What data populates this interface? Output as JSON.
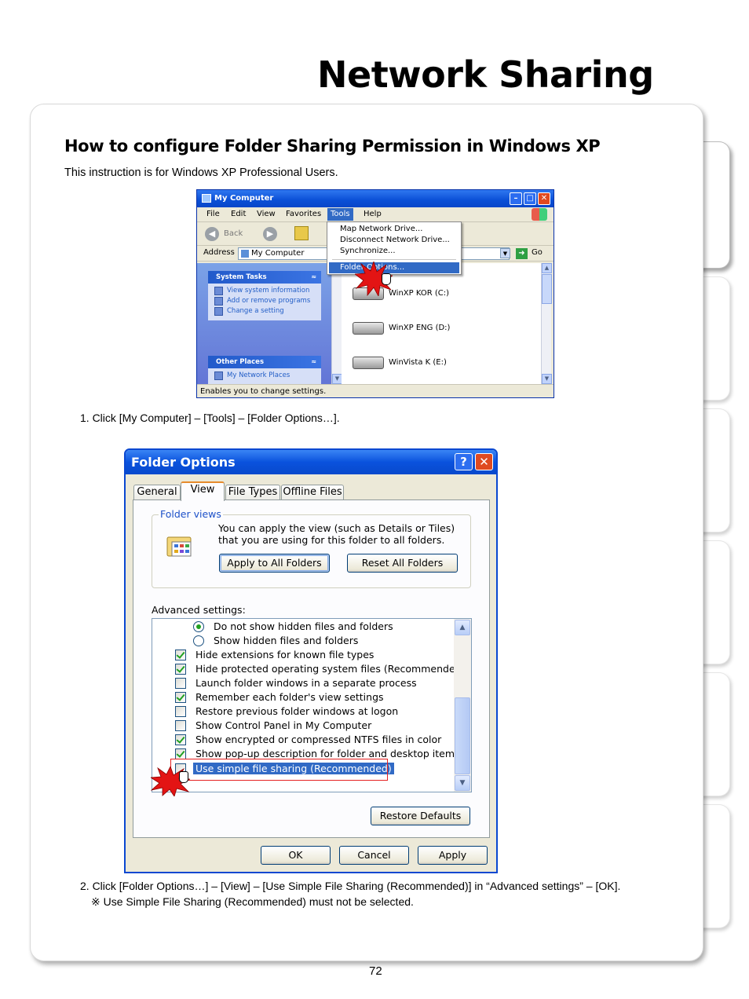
{
  "page_title": "Network Sharing",
  "section_heading": "How to configure Folder Sharing Permission in Windows XP",
  "intro": "This instruction is for Windows XP Professional Users.",
  "my_computer": {
    "title": "My Computer",
    "menu": [
      "File",
      "Edit",
      "View",
      "Favorites",
      "Tools",
      "Help"
    ],
    "toolbar_back": "Back",
    "address_label": "Address",
    "address_value": "My Computer",
    "go_label": "Go",
    "tools_menu": [
      "Map Network Drive...",
      "Disconnect Network Drive...",
      "Synchronize...",
      "Folder Options..."
    ],
    "system_tasks": {
      "heading": "System Tasks",
      "items": [
        "View system information",
        "Add or remove programs",
        "Change a setting"
      ]
    },
    "other_places": {
      "heading": "Other Places",
      "items": [
        "My Network Places"
      ]
    },
    "drives": [
      "WinXP KOR (C:)",
      "WinXP ENG (D:)",
      "WinVista K (E:)"
    ],
    "status": "Enables you to change settings."
  },
  "step1": "1. Click [My Computer] – [Tools] – [Folder Options…].",
  "folder_options": {
    "title": "Folder Options",
    "help_btn": "?",
    "close_btn": "✕",
    "tabs": [
      "General",
      "View",
      "File Types",
      "Offline Files"
    ],
    "folder_views_legend": "Folder views",
    "folder_views_text": "You can apply the view (such as Details or Tiles) that you are using for this folder to all folders.",
    "apply_all": "Apply to All Folders",
    "reset_all": "Reset All Folders",
    "advanced_label": "Advanced settings:",
    "advanced_items": [
      {
        "type": "radio",
        "checked": true,
        "label": "Do not show hidden files and folders"
      },
      {
        "type": "radio",
        "checked": false,
        "label": "Show hidden files and folders"
      },
      {
        "type": "check",
        "checked": true,
        "label": "Hide extensions for known file types"
      },
      {
        "type": "check",
        "checked": true,
        "label": "Hide protected operating system files (Recommended)"
      },
      {
        "type": "check",
        "checked": false,
        "label": "Launch folder windows in a separate process"
      },
      {
        "type": "check",
        "checked": true,
        "label": "Remember each folder's view settings"
      },
      {
        "type": "check",
        "checked": false,
        "label": "Restore previous folder windows at logon"
      },
      {
        "type": "check",
        "checked": false,
        "label": "Show Control Panel in My Computer"
      },
      {
        "type": "check",
        "checked": true,
        "label": "Show encrypted or compressed NTFS files in color"
      },
      {
        "type": "check",
        "checked": true,
        "label": "Show pop-up description for folder and desktop items"
      },
      {
        "type": "check",
        "checked": false,
        "label": "Use simple file sharing (Recommended)",
        "selected": true
      }
    ],
    "restore_defaults": "Restore Defaults",
    "ok": "OK",
    "cancel": "Cancel",
    "apply": "Apply"
  },
  "step2": "2. Click [Folder Options…] – [View] – [Use Simple File Sharing (Recommended)] in “Advanced settings” – [OK].",
  "note": "※ Use Simple File Sharing (Recommended) must not be selected.",
  "page_number": "72",
  "colors": {
    "xp_blue": "#0a4fd6",
    "highlight": "#316ac5",
    "callout_red": "#e52020"
  }
}
